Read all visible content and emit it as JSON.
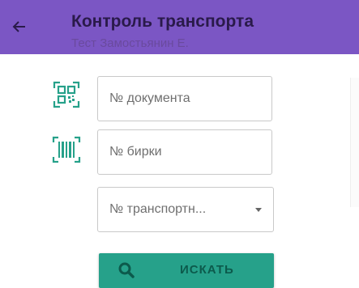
{
  "appbar": {
    "title": "Контроль транспорта",
    "subtitle": "Тест Замостьянин Е.",
    "back_icon": "arrow-left-icon",
    "bg_color": "#7b56c4"
  },
  "form": {
    "document_placeholder": "№ документа",
    "tag_placeholder": "№ бирки",
    "transport_select": "№ транспортн...",
    "qr_icon": "qr-code-icon",
    "barcode_icon": "barcode-icon",
    "icon_color": "#26a18a"
  },
  "search": {
    "label": "ИСКАТЬ",
    "icon": "search-icon",
    "color": "#26a18a"
  }
}
